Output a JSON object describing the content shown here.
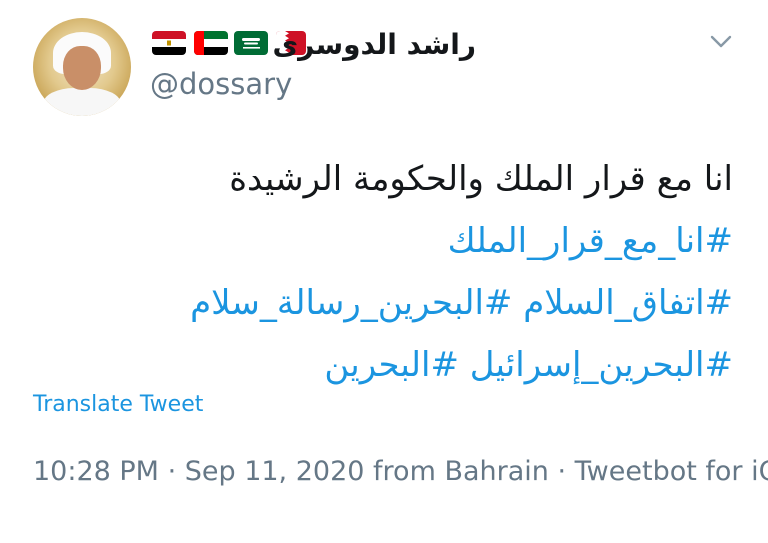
{
  "profile": {
    "display_name": "راشد الدوسرى",
    "handle": "@dossary",
    "flags": [
      "egypt-flag-icon",
      "uae-flag-icon",
      "saudi-flag-icon",
      "bahrain-flag-icon"
    ]
  },
  "tweet": {
    "text_line": "انا مع قرار الملك والحكومة الرشيدة",
    "hashtag_line_1": "#انا_مع_قرار_الملك",
    "hashtag_line_2": "#اتفاق_السلام #البحرين_رسالة_سلام",
    "hashtag_line_3": "#البحرين_إسرائيل #البحرين"
  },
  "translate_label": "Translate Tweet",
  "meta": {
    "time": "10:28 PM",
    "separator": " · ",
    "date": "Sep 11, 2020",
    "location": " from Bahrain",
    "client": "Tweetbot for iOS"
  },
  "colors": {
    "link": "#1b95e0",
    "secondary_text": "#657786",
    "primary_text": "#14171a"
  }
}
